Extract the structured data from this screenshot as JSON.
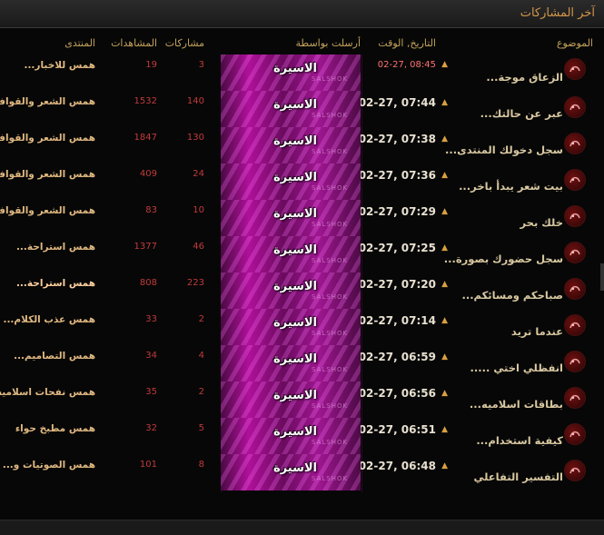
{
  "section_title": "آخر المشاركات",
  "columns": {
    "topic": "الموضوع",
    "date": "التاريخ, الوقت",
    "poster": "أرسلت بواسطة",
    "replies": "مشاركات",
    "views": "المشاهدات",
    "forum": "المنتدى"
  },
  "poster_watermark": "SALSHOK",
  "rows": [
    {
      "topic": "الزعاق موجة...",
      "date": "02-27, 08:45",
      "poster": "الاسيرة",
      "replies": "3",
      "views": "19",
      "forum": "همس للاخبار..."
    },
    {
      "topic": "عبر عن حالتك...",
      "date": "02-27, 07:44",
      "poster": "الاسيرة",
      "replies": "140",
      "views": "1532",
      "forum": "همس الشعر والقوافي"
    },
    {
      "topic": "سجل دخولك المنتدى...",
      "date": "02-27, 07:38",
      "poster": "الاسيرة",
      "replies": "130",
      "views": "1847",
      "forum": "همس الشعر والقوافي"
    },
    {
      "topic": "بيت شعر يبدأ باخر...",
      "date": "02-27, 07:36",
      "poster": "الاسيرة",
      "replies": "24",
      "views": "409",
      "forum": "همس الشعر والقوافي"
    },
    {
      "topic": "خلك بحر",
      "date": "02-27, 07:29",
      "poster": "الاسيرة",
      "replies": "10",
      "views": "83",
      "forum": "همس الشعر والقوافي"
    },
    {
      "topic": "سجل حضورك بصورة...",
      "date": "02-27, 07:25",
      "poster": "الاسيرة",
      "replies": "46",
      "views": "1377",
      "forum": "همس استراحة..."
    },
    {
      "topic": "صباحكم ومسائكم...",
      "date": "02-27, 07:20",
      "poster": "الاسيرة",
      "replies": "223",
      "views": "808",
      "forum": "همس استراحة..."
    },
    {
      "topic": "عندما تريد",
      "date": "02-27, 07:14",
      "poster": "الاسيرة",
      "replies": "2",
      "views": "33",
      "forum": "همس عذب الكلام..."
    },
    {
      "topic": "انفظلي اختي .....",
      "date": "02-27, 06:59",
      "poster": "الاسيرة",
      "replies": "4",
      "views": "34",
      "forum": "همس التصاميم..."
    },
    {
      "topic": "بطاقات اسلاميه...",
      "date": "02-27, 06:56",
      "poster": "الاسيرة",
      "replies": "2",
      "views": "35",
      "forum": "همس نفحات اسلاميه"
    },
    {
      "topic": "كيفية استخدام...",
      "date": "02-27, 06:51",
      "poster": "الاسيرة",
      "replies": "5",
      "views": "32",
      "forum": "همس مطبخ حواء"
    },
    {
      "topic": "التفسير التفاعلي",
      "date": "02-27, 06:48",
      "poster": "الاسيرة",
      "replies": "8",
      "views": "101",
      "forum": "همس الصوتيات و..."
    }
  ]
}
